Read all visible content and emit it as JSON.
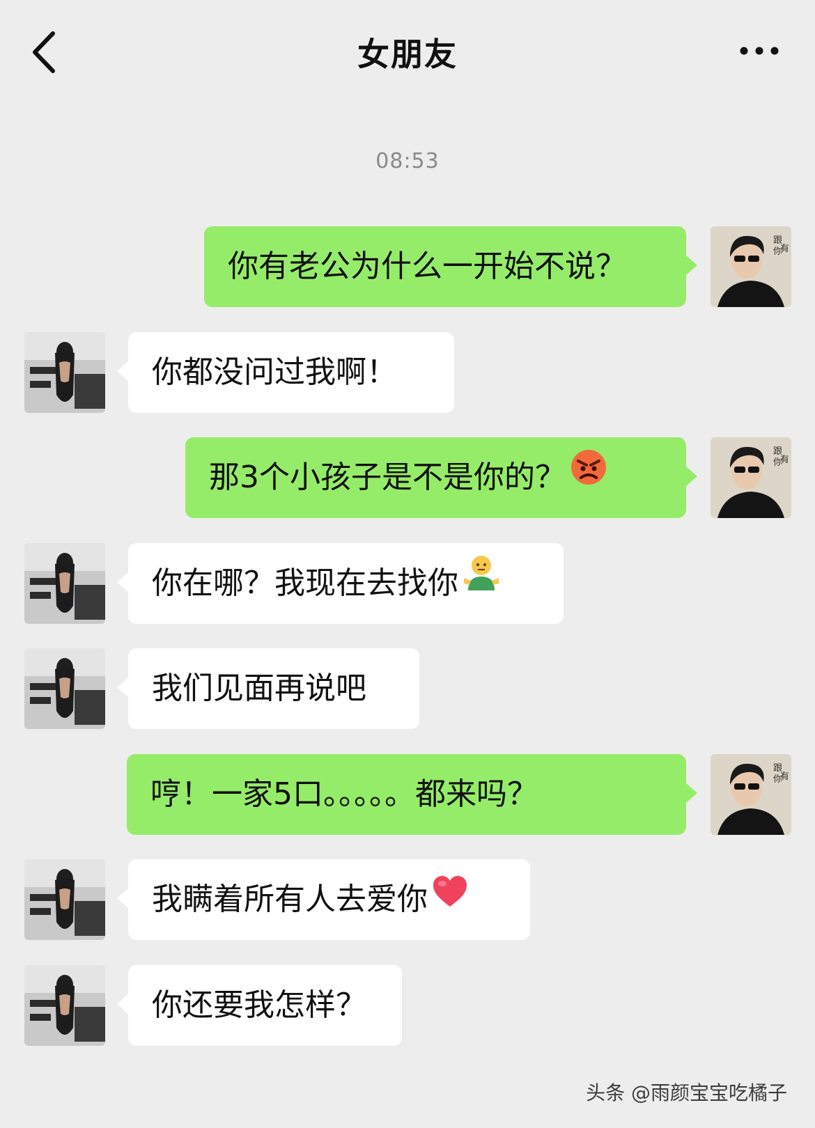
{
  "header": {
    "title": "女朋友",
    "back_icon": "chevron-left-icon",
    "more_icon": "more-dots-icon"
  },
  "chat": {
    "timestamp": "08:53",
    "messages": [
      {
        "sender": "me",
        "text": "你有老公为什么一开始不说？"
      },
      {
        "sender": "her",
        "text": "你都没问过我啊！"
      },
      {
        "sender": "me",
        "text": "那3个小孩子是不是你的？",
        "emoji": "angry-face-icon"
      },
      {
        "sender": "her",
        "text": "你在哪？我现在去找你",
        "emoji": "shrug-person-icon"
      },
      {
        "sender": "her",
        "text": "我们见面再说吧"
      },
      {
        "sender": "me",
        "text": "哼！一家5口。。。。。都来吗？"
      },
      {
        "sender": "her",
        "text": "我瞒着所有人去爱你",
        "emoji": "red-heart-icon"
      },
      {
        "sender": "her",
        "text": "你还要我怎样？"
      }
    ]
  },
  "watermark": "头条 @雨颜宝宝吃橘子",
  "colors": {
    "background": "#ededed",
    "my_bubble": "#95ec69",
    "her_bubble": "#ffffff"
  }
}
